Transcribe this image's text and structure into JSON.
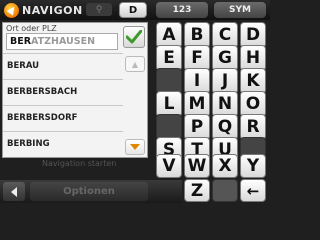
{
  "header": {
    "brand": "NAVIGON",
    "country_button": "D",
    "numbers_button": "123",
    "symbols_button": "SYM"
  },
  "search": {
    "label": "Ort oder PLZ",
    "typed": "BER",
    "completion": "ATZHAUSEN"
  },
  "results": [
    {
      "label": "BERAU"
    },
    {
      "label": "BERBERSBACH"
    },
    {
      "label": "BERBERSDORF"
    },
    {
      "label": "BERBING"
    }
  ],
  "keyboard": {
    "keys": [
      "A",
      "B",
      "C",
      "D",
      "E",
      "F",
      "G",
      "H",
      "I",
      "J",
      "K",
      "L",
      "M",
      "N",
      "O",
      "P",
      "Q",
      "R",
      "S",
      "T",
      "U",
      "V",
      "W",
      "X",
      "Y",
      "Z",
      "←"
    ]
  },
  "dimmed": {
    "text": "Navigation starten"
  },
  "footer": {
    "options_label": "Optionen"
  },
  "colors": {
    "accent": "#e08600",
    "check": "#3c9a2a"
  }
}
